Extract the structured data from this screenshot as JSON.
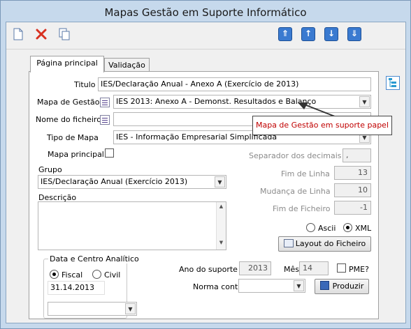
{
  "window": {
    "title": "Mapas Gestão em Suporte Informático"
  },
  "toolbar": {
    "new_icon": "new-document-icon",
    "delete_icon": "red-x-icon",
    "copy_icon": "copy-icon",
    "first_icon": "arrow-up-first-icon",
    "prev_icon": "arrow-up-icon",
    "next_icon": "arrow-down-icon",
    "last_icon": "arrow-down-last-icon",
    "first_glyph": "⇑",
    "prev_glyph": "↑",
    "next_glyph": "↓",
    "last_glyph": "⇓"
  },
  "tabs": [
    {
      "label": "Página principal",
      "active": true
    },
    {
      "label": "Validação",
      "active": false
    }
  ],
  "form": {
    "titulo_label": "Titulo",
    "titulo_value": "IES/Declaração Anual - Anexo A (Exercício de 2013)",
    "mapa_label": "Mapa de Gestão",
    "mapa_value": "IES 2013: Anexo A - Demonst. Resultados e Balanço",
    "ficheiro_label": "Nome do ficheiro",
    "ficheiro_value": "",
    "tipo_label": "Tipo de Mapa",
    "tipo_value": "IES - Informação Empresarial Simplificada",
    "principal_label": "Mapa principal",
    "principal_checked": false,
    "grupo_label": "Grupo",
    "grupo_value": "IES/Declaração Anual (Exercício 2013)",
    "descricao_label": "Descrição",
    "descricao_value": ""
  },
  "file_settings": {
    "separador_label": "Separador dos decimais",
    "separador_value": ",",
    "fim_linha_label": "Fim de Linha",
    "fim_linha_value": "13",
    "mudanca_label": "Mudança de Linha",
    "mudanca_value": "10",
    "fim_ficheiro_label": "Fim de Ficheiro",
    "fim_ficheiro_value": "-1",
    "format_ascii": "Ascii",
    "format_xml": "XML",
    "selected_format": "XML",
    "layout_button": "Layout do Ficheiro"
  },
  "analytic": {
    "group_title": "Data e Centro Analítico",
    "fiscal_label": "Fiscal",
    "civil_label": "Civil",
    "selected": "Fiscal",
    "date_value": "31.14.2013",
    "centro_value": ""
  },
  "support": {
    "ano_label": "Ano do suporte",
    "ano_value": "2013",
    "mes_label": "Mês",
    "mes_value": "14",
    "pme_label": "PME?",
    "pme_checked": false,
    "norma_label": "Norma cont.",
    "norma_value": "",
    "produzir_button": "Produzir"
  },
  "tooltip": {
    "text": "Mapa de Gestão em suporte papel"
  },
  "colors": {
    "tooltip_text": "#c00000",
    "toolbar_blue": "#3a7ad0",
    "delete_red": "#d83020"
  }
}
